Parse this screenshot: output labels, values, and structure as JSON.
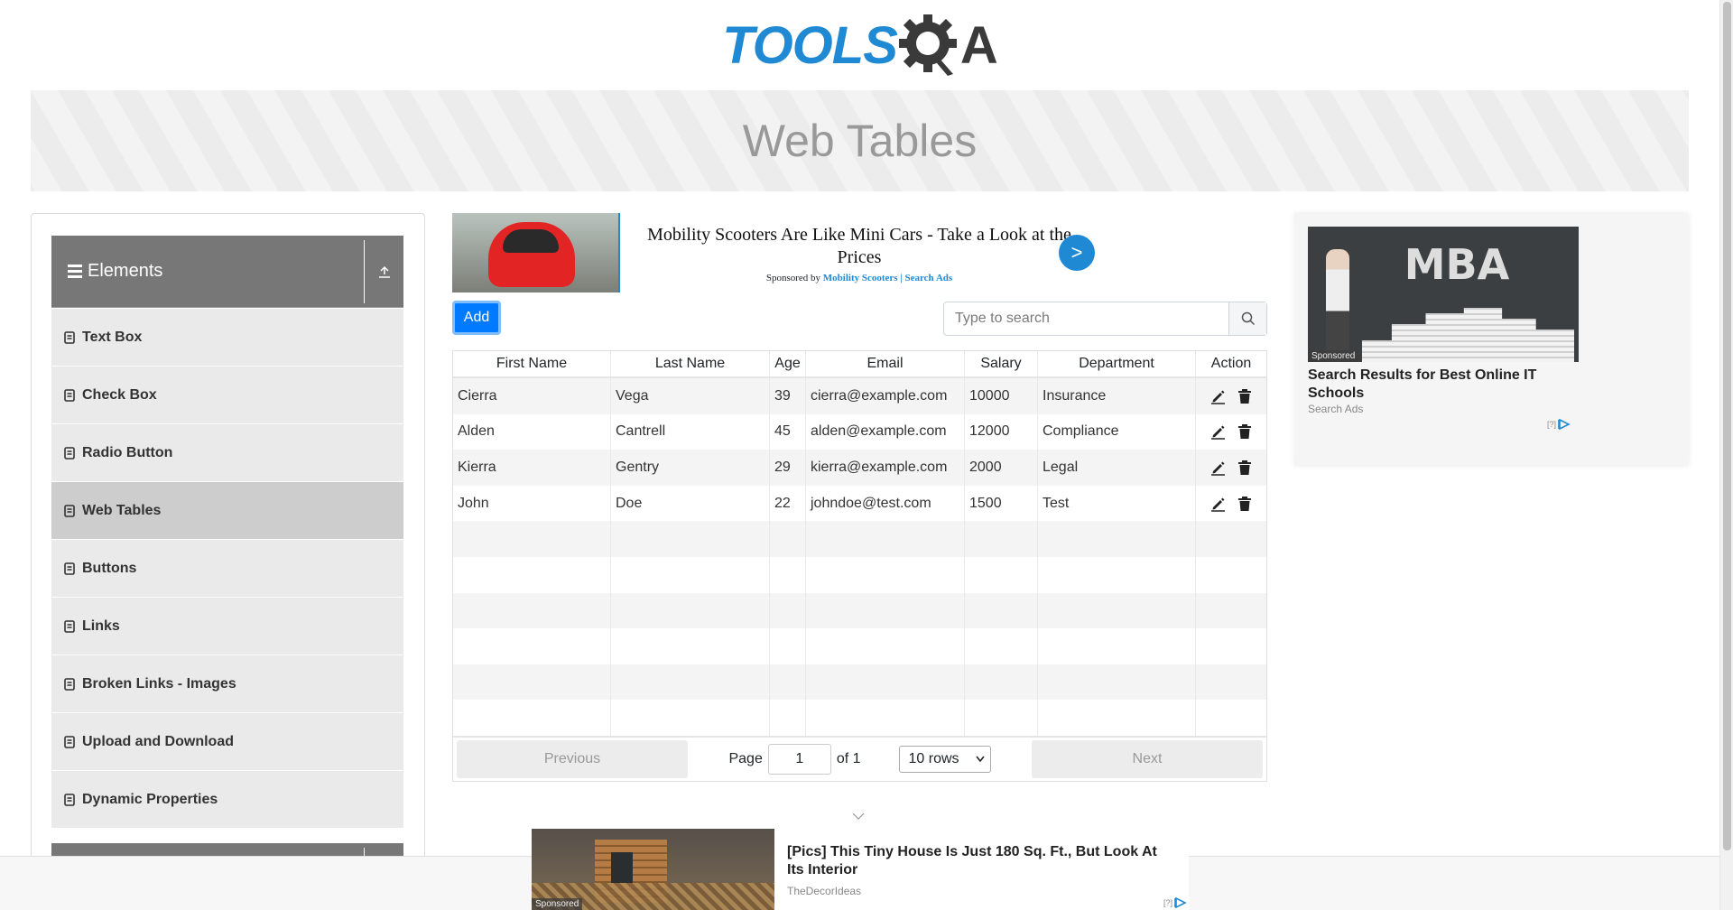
{
  "header": {
    "logo_tools": "TOOLS",
    "logo_qa": "A",
    "page_title": "Web Tables"
  },
  "sidebar": {
    "group_title": "Elements",
    "items": [
      {
        "label": "Text Box"
      },
      {
        "label": "Check Box"
      },
      {
        "label": "Radio Button"
      },
      {
        "label": "Web Tables",
        "active": true
      },
      {
        "label": "Buttons"
      },
      {
        "label": "Links"
      },
      {
        "label": "Broken Links - Images"
      },
      {
        "label": "Upload and Download"
      },
      {
        "label": "Dynamic Properties"
      }
    ]
  },
  "top_ad": {
    "headline": "Mobility Scooters Are Like Mini Cars - Take a Look at the Prices",
    "sponsored_by": "Sponsored by",
    "sponsor": "Mobility Scooters | Search Ads",
    "go_label": ">"
  },
  "toolbar": {
    "add_label": "Add",
    "search_placeholder": "Type to search"
  },
  "table": {
    "columns": [
      "First Name",
      "Last Name",
      "Age",
      "Email",
      "Salary",
      "Department",
      "Action"
    ],
    "rows": [
      [
        "Cierra",
        "Vega",
        "39",
        "cierra@example.com",
        "10000",
        "Insurance"
      ],
      [
        "Alden",
        "Cantrell",
        "45",
        "alden@example.com",
        "12000",
        "Compliance"
      ],
      [
        "Kierra",
        "Gentry",
        "29",
        "kierra@example.com",
        "2000",
        "Legal"
      ],
      [
        "John",
        "Doe",
        "22",
        "johndoe@test.com",
        "1500",
        "Test"
      ]
    ],
    "empty_rows": 6
  },
  "pagination": {
    "previous": "Previous",
    "next": "Next",
    "page_label": "Page",
    "page_value": "1",
    "of_label": "of 1",
    "rows_option": "10 rows"
  },
  "right_ad": {
    "tag": "Sponsored",
    "chalk_text": "MBA",
    "headline": "Search Results for Best Online IT Schools",
    "source": "Search Ads",
    "info": "[?]"
  },
  "bottom_ad": {
    "tag": "Sponsored",
    "headline": "[Pics] This Tiny House Is Just 180 Sq. Ft., But Look At Its Interior",
    "source": "TheDecorIdeas",
    "info": "[?]"
  },
  "colors": {
    "brand_blue": "#1f8ad3",
    "primary_button": "#007bff",
    "sidebar_header": "#777777",
    "menu_item_bg": "#eaeaea",
    "menu_item_active": "#cdcdcd"
  }
}
